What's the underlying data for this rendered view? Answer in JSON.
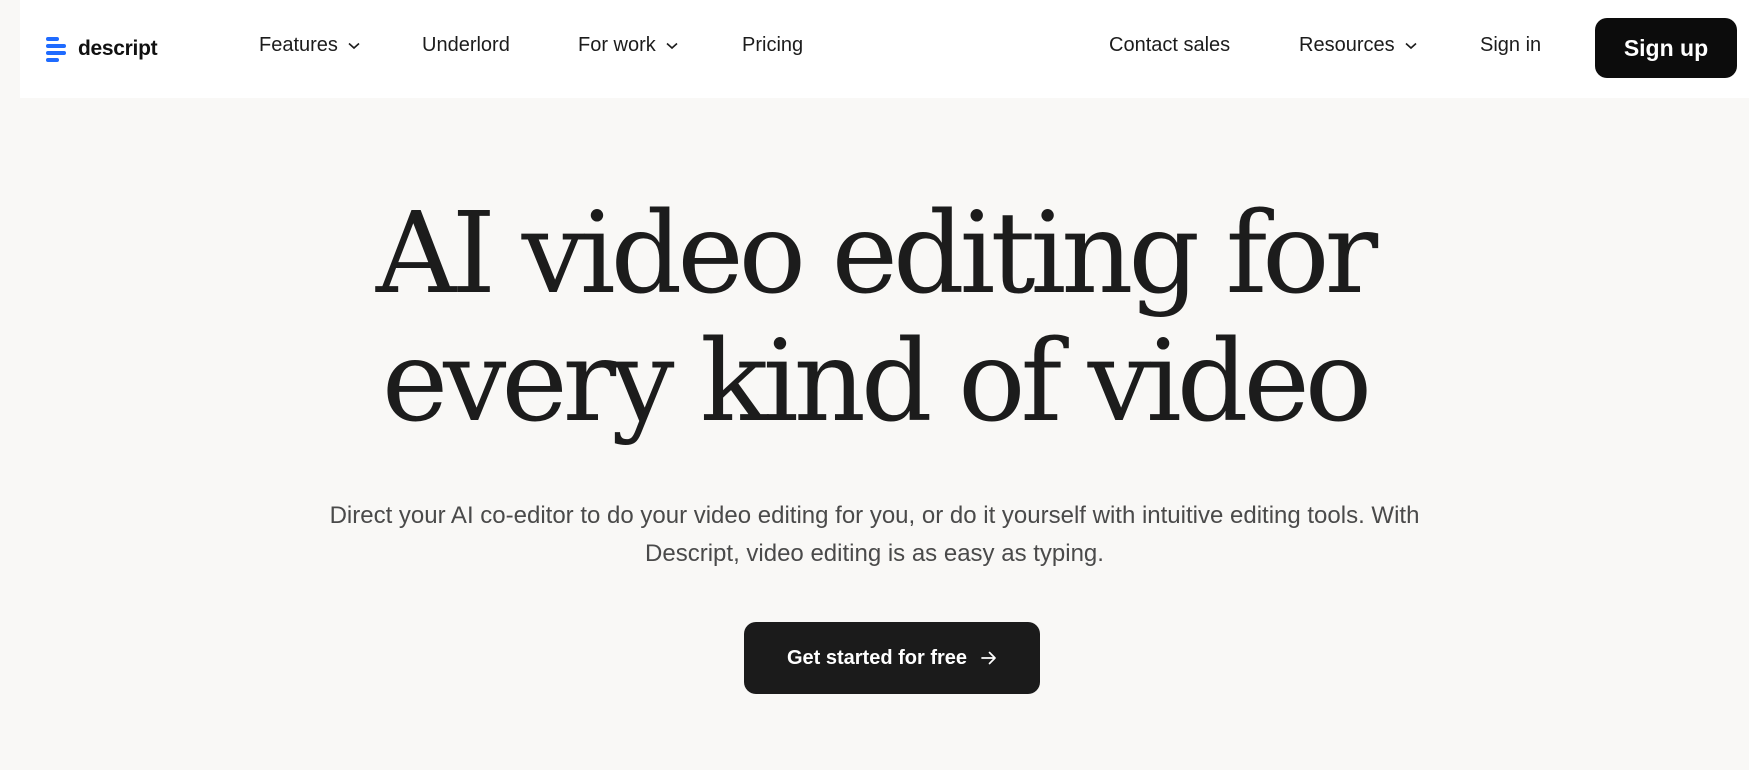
{
  "brand": {
    "name": "descript",
    "logo_icon": "descript-logo-icon",
    "accent_color": "#1f6bff"
  },
  "nav": {
    "left": [
      {
        "label": "Features",
        "has_dropdown": true
      },
      {
        "label": "Underlord",
        "has_dropdown": false
      },
      {
        "label": "For work",
        "has_dropdown": true
      },
      {
        "label": "Pricing",
        "has_dropdown": false
      }
    ],
    "right": [
      {
        "label": "Contact sales",
        "has_dropdown": false
      },
      {
        "label": "Resources",
        "has_dropdown": true
      },
      {
        "label": "Sign in",
        "has_dropdown": false
      }
    ],
    "signup_label": "Sign up"
  },
  "hero": {
    "headline_line1": "AI video editing for",
    "headline_line2": "every kind of video",
    "subtext_line1": "Direct your AI co-editor to do your video editing for you, or do it yourself with intuitive editing tools. With",
    "subtext_line2": "Descript, video editing is as easy as typing.",
    "cta_label": "Get started for free",
    "cta_icon": "arrow-right-icon"
  },
  "colors": {
    "page_background": "#f9f8f6",
    "header_background": "#ffffff",
    "button_dark": "#0c0c0c",
    "text_primary": "#1c1c1c",
    "text_secondary": "#4a4a4a"
  }
}
